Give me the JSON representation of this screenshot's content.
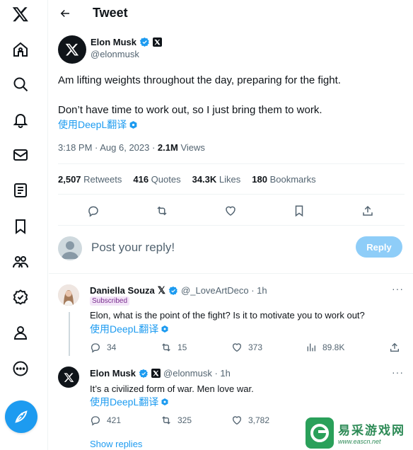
{
  "header": {
    "title": "Tweet"
  },
  "tweet": {
    "author_name": "Elon Musk",
    "author_handle": "@elonmusk",
    "text_line1": "Am lifting weights throughout the day, preparing for the fight.",
    "text_line2": "Don’t have time to work out, so I just bring them to work.",
    "translate_label": "使用DeepL翻译",
    "time": "3:18 PM · Aug 6, 2023 · ",
    "views_count": "2.1M",
    "views_label": " Views",
    "stats": {
      "retweets_count": "2,507",
      "retweets_label": " Retweets",
      "quotes_count": "416",
      "quotes_label": " Quotes",
      "likes_count": "34.3K",
      "likes_label": " Likes",
      "bookmarks_count": "180",
      "bookmarks_label": " Bookmarks"
    }
  },
  "composer": {
    "placeholder": "Post your reply!",
    "button_label": "Reply"
  },
  "replies": [
    {
      "name": "Daniella Souza",
      "handle_time": "@_LoveArtDeco · 1h",
      "badge": "Subscribed",
      "text": "Elon, what is the point of the fight? Is it to motivate you to work out?",
      "translate_label": "使用DeepL翻译",
      "replies": "34",
      "retweets": "15",
      "likes": "373",
      "views": "89.8K"
    },
    {
      "name": "Elon Musk",
      "handle_time": "@elonmusk · 1h",
      "text": "It’s a civilized form of war. Men love war.",
      "translate_label": "使用DeepL翻译",
      "replies": "421",
      "retweets": "325",
      "likes": "3,782"
    }
  ],
  "show_replies_label": "Show replies",
  "watermark": {
    "main": "易采游戏网",
    "url": "www.eascn.net"
  },
  "colors": {
    "accent": "#1d9bf0",
    "text": "#0f1419",
    "muted": "#536471",
    "border": "#eff3f4",
    "reply_disabled": "#8ecdf8"
  },
  "icons": [
    "x-logo-icon",
    "home-icon",
    "search-icon",
    "bell-icon",
    "mail-icon",
    "lists-icon",
    "bookmark-icon",
    "communities-icon",
    "verified-icon",
    "profile-icon",
    "more-icon",
    "compose-icon",
    "back-arrow-icon",
    "reply-icon",
    "retweet-icon",
    "like-icon",
    "share-icon",
    "views-icon",
    "more-dots-icon"
  ]
}
